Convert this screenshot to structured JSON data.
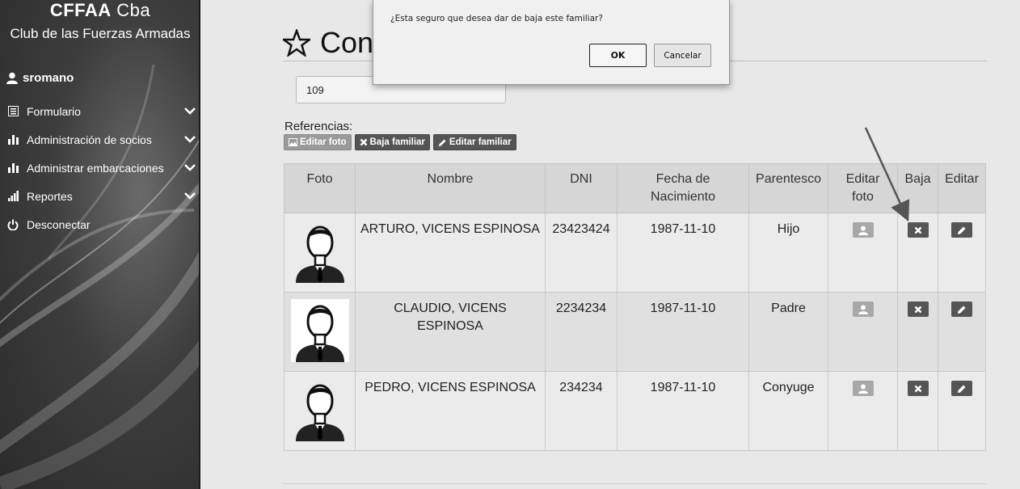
{
  "sidebar": {
    "brand_bold": "CFFAA",
    "brand_light": " Cba",
    "subtitle": "Club de las Fuerzas Armadas",
    "username": "sromano",
    "items": [
      {
        "label": "Formulario",
        "icon": "list-icon"
      },
      {
        "label": "Administración de socios",
        "icon": "bar-chart-icon"
      },
      {
        "label": "Administrar embarcaciones",
        "icon": "bar-chart-icon"
      },
      {
        "label": "Reportes",
        "icon": "signal-icon"
      },
      {
        "label": "Desconectar",
        "icon": "power-icon"
      }
    ]
  },
  "main": {
    "title": "Con",
    "id_value": "109",
    "refs_label": "Referencias:",
    "ref_buttons": {
      "edit_photo": "Editar foto",
      "remove_member": "Baja familiar",
      "edit_member": "Editar familiar"
    }
  },
  "table": {
    "headers": {
      "foto": "Foto",
      "nombre": "Nombre",
      "dni": "DNI",
      "fecha_1": "Fecha de",
      "fecha_2": "Nacimiento",
      "parentesco": "Parentesco",
      "editar_foto_1": "Editar",
      "editar_foto_2": "foto",
      "baja": "Baja",
      "editar": "Editar"
    },
    "rows": [
      {
        "nombre": "ARTURO, VICENS ESPINOSA",
        "dni": "23423424",
        "fecha": "1987-11-10",
        "parentesco": "Hijo"
      },
      {
        "nombre": "CLAUDIO, VICENS ESPINOSA",
        "dni": "2234234",
        "fecha": "1987-11-10",
        "parentesco": "Padre"
      },
      {
        "nombre": "PEDRO, VICENS ESPINOSA",
        "dni": "234234",
        "fecha": "1987-11-10",
        "parentesco": "Conyuge"
      }
    ]
  },
  "dialog": {
    "message": "¿Esta seguro que desea dar de baja este familiar?",
    "ok_label": "OK",
    "cancel_label": "Cancelar"
  }
}
